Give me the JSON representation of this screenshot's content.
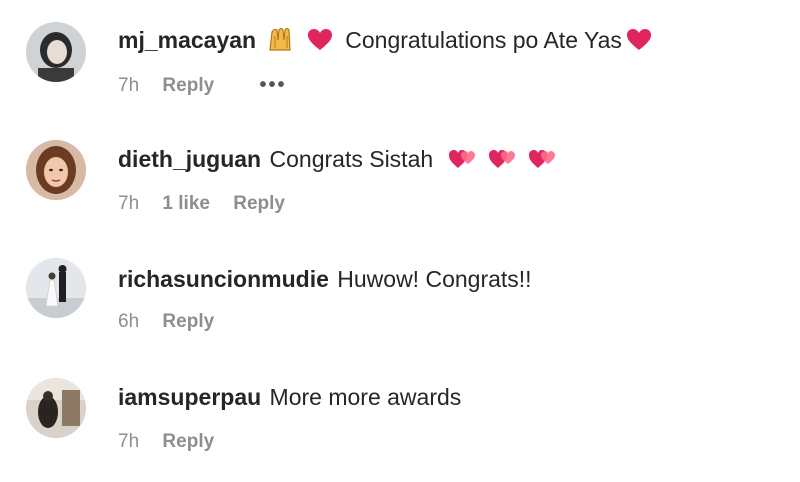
{
  "comments": [
    {
      "username": "mj_macayan",
      "text": "Congratulations po Ate Yas",
      "time": "7h",
      "likes": "",
      "reply_label": "Reply",
      "more_label": "•••"
    },
    {
      "username": "dieth_juguan",
      "text": "Congrats Sistah",
      "time": "7h",
      "likes": "1 like",
      "reply_label": "Reply"
    },
    {
      "username": "richasuncionmudie",
      "text": "Huwow! Congrats!!",
      "time": "6h",
      "likes": "",
      "reply_label": "Reply"
    },
    {
      "username": "iamsuperpau",
      "text": "More more awards",
      "time": "7h",
      "likes": "",
      "reply_label": "Reply"
    }
  ],
  "colors": {
    "username": "#262626",
    "meta": "#8e8e8e",
    "heart": "#e0245e"
  },
  "icons": {
    "praise": "raising-hands-icon",
    "heart": "red-heart-icon",
    "two_hearts": "revolving-hearts-icon"
  }
}
